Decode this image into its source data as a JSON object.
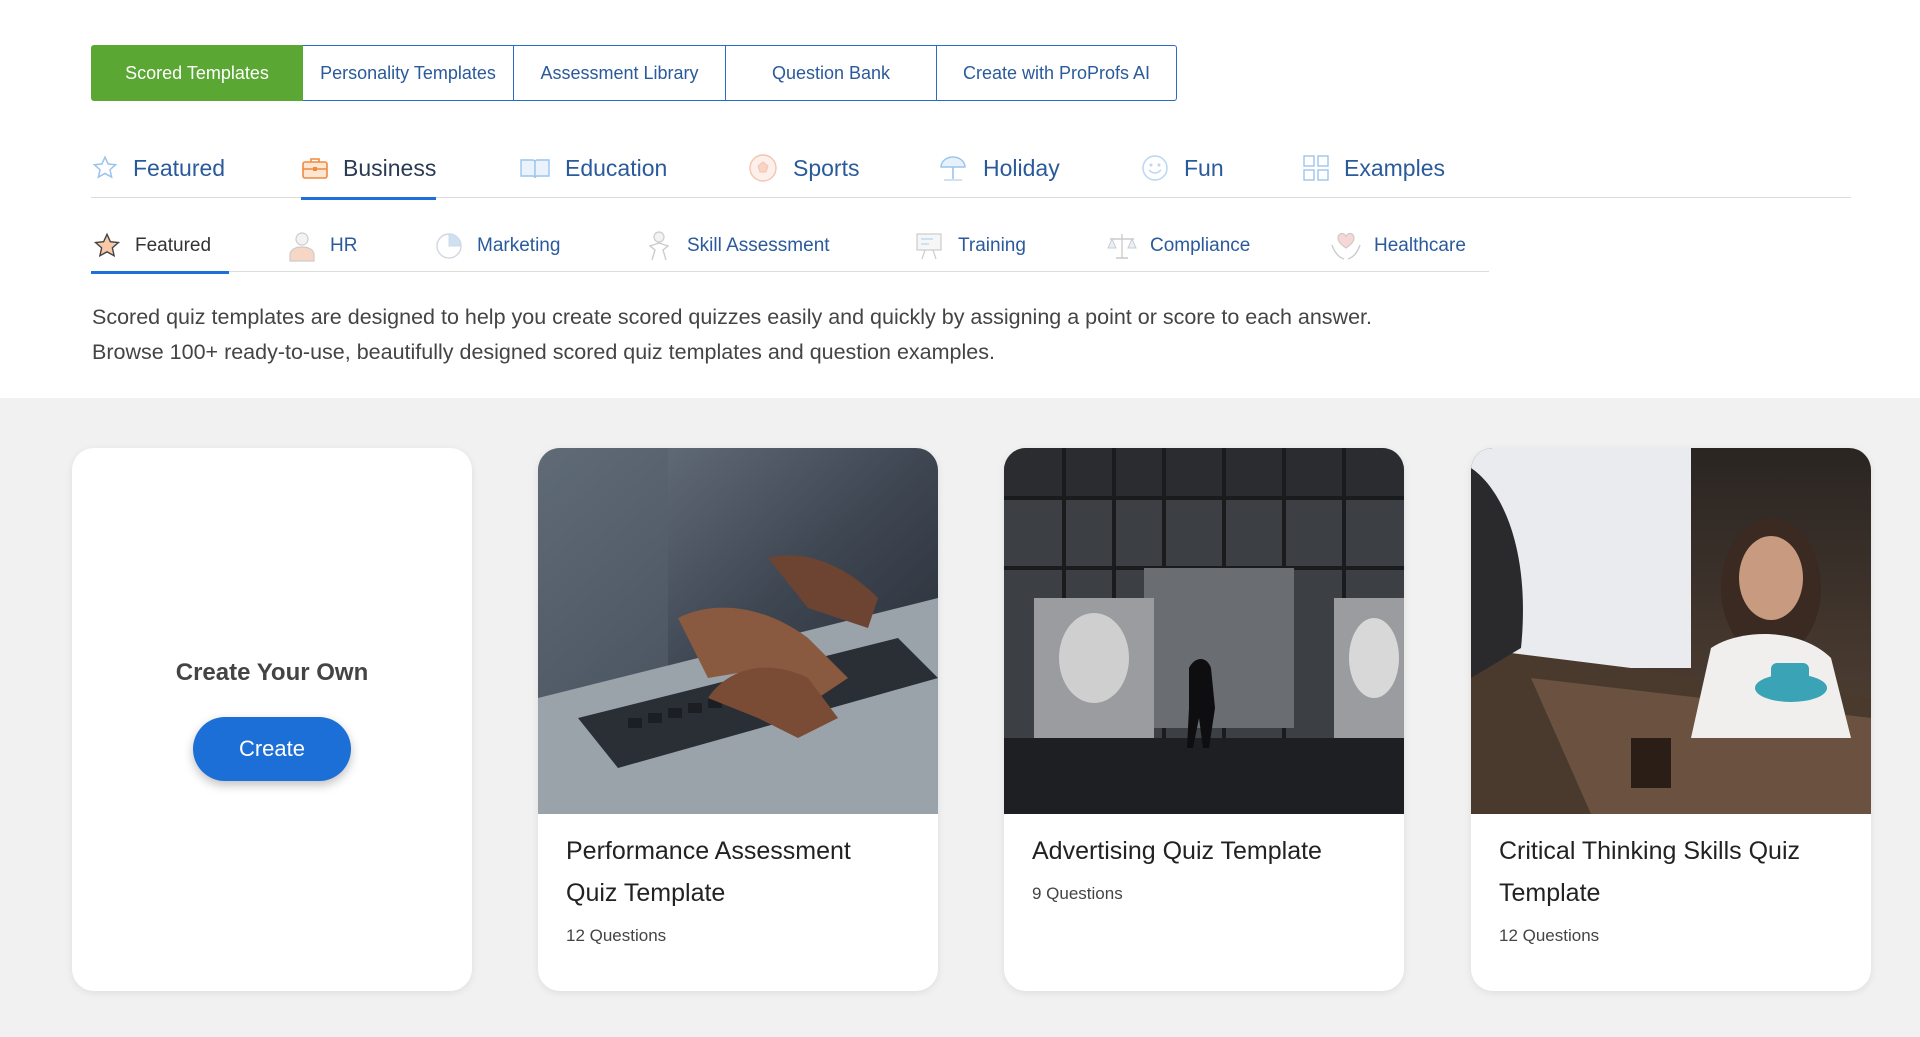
{
  "top_tabs": [
    {
      "label": "Scored Templates",
      "active": true
    },
    {
      "label": "Personality Templates"
    },
    {
      "label": "Assessment Library"
    },
    {
      "label": "Question Bank"
    },
    {
      "label": "Create with ProProfs AI"
    }
  ],
  "categories": [
    {
      "label": "Featured",
      "icon": "star-icon"
    },
    {
      "label": "Business",
      "icon": "briefcase-icon",
      "active": true
    },
    {
      "label": "Education",
      "icon": "book-icon"
    },
    {
      "label": "Sports",
      "icon": "ball-icon"
    },
    {
      "label": "Holiday",
      "icon": "beach-umbrella-icon"
    },
    {
      "label": "Fun",
      "icon": "smiley-icon"
    },
    {
      "label": "Examples",
      "icon": "grid-icon"
    }
  ],
  "subcategories": [
    {
      "label": "Featured",
      "icon": "star-icon",
      "active": true
    },
    {
      "label": "HR",
      "icon": "person-icon"
    },
    {
      "label": "Marketing",
      "icon": "pie-chart-icon"
    },
    {
      "label": "Skill Assessment",
      "icon": "skill-icon"
    },
    {
      "label": "Training",
      "icon": "training-board-icon"
    },
    {
      "label": "Compliance",
      "icon": "scales-icon"
    },
    {
      "label": "Healthcare",
      "icon": "heart-hands-icon"
    }
  ],
  "description": {
    "line1": "Scored quiz templates are designed to help you create scored quizzes easily and quickly by assigning a point or score to each answer.",
    "line2": "Browse 100+ ready-to-use, beautifully designed scored quiz templates and question examples."
  },
  "create_card": {
    "title": "Create Your Own",
    "button": "Create"
  },
  "templates": [
    {
      "title_line1": "Performance Assessment",
      "title_line2": "Quiz Template",
      "questions": "12 Questions"
    },
    {
      "title_line1": "Advertising Quiz Template",
      "title_line2": "",
      "questions": "9 Questions"
    },
    {
      "title_line1": "Critical Thinking Skills Quiz",
      "title_line2": "Template",
      "questions": "12 Questions"
    }
  ],
  "colors": {
    "accent_green": "#5aa733",
    "accent_blue": "#1c6fd6",
    "link_blue": "#2a5a9c"
  }
}
